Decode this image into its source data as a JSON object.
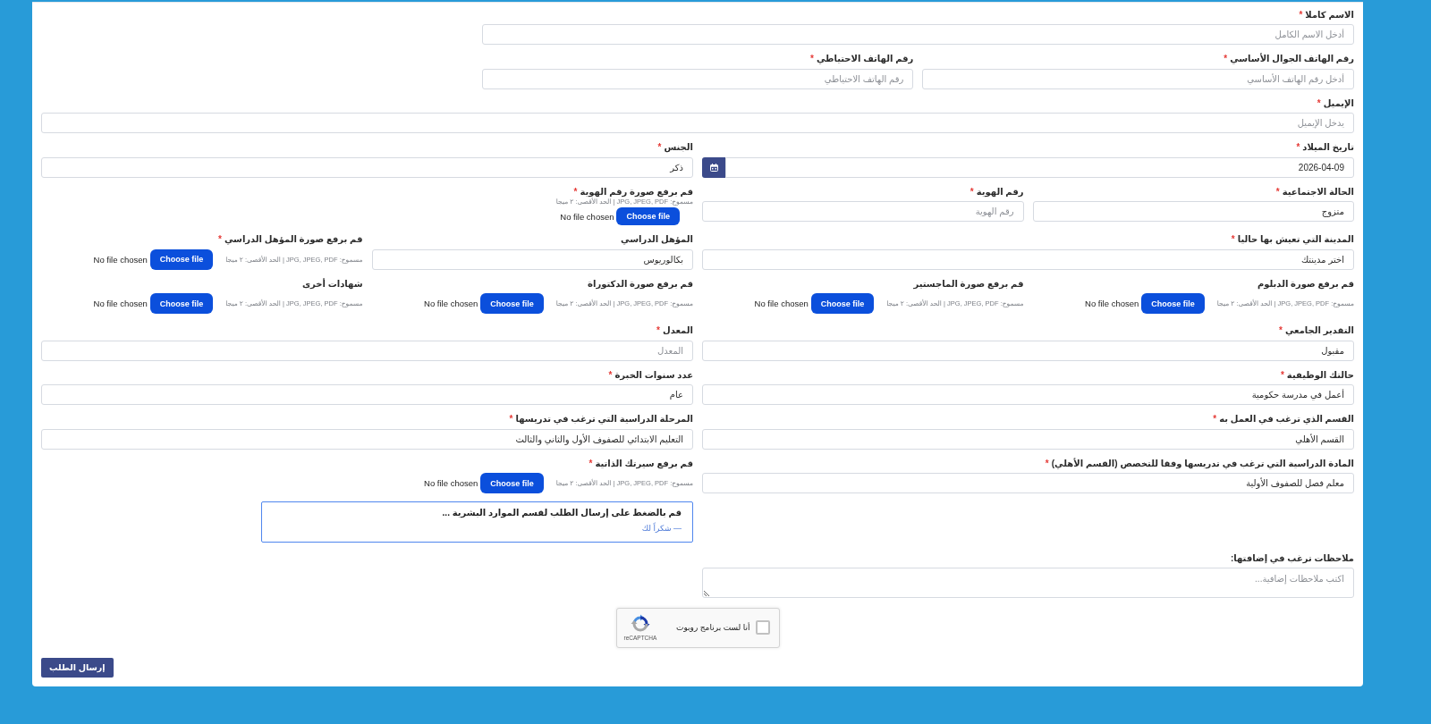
{
  "form": {
    "rows": [
      {
        "fields": [
          {
            "kind": "text",
            "label": "الاسم كاملا",
            "asterisk": "*",
            "placeholder": "أدخل الاسم الكامل"
          }
        ]
      },
      {
        "fields": [
          {
            "kind": "text",
            "label": "رقم الهاتف الجوال الأساسي",
            "asterisk": "*",
            "placeholder": "أدخل رقم الهاتف الأساسي"
          },
          {
            "kind": "text",
            "label": "رقم الهاتف الاحتياطي",
            "asterisk": "*",
            "placeholder": "رقم الهاتف الاحتياطي"
          }
        ]
      },
      {
        "fields": [
          {
            "kind": "text",
            "label": "الإيميل",
            "asterisk": "*",
            "placeholder": "يدخل الإيميل"
          }
        ]
      },
      {
        "fields": [
          {
            "kind": "date",
            "label": "تاريخ الميلاد",
            "asterisk": "*",
            "value": "2026-04-09"
          },
          {
            "kind": "text",
            "label": "الجنس",
            "asterisk": "*",
            "value": "ذكر"
          }
        ]
      },
      {
        "fields": [
          {
            "kind": "text",
            "label": "الحالة الاجتماعية",
            "asterisk": "*",
            "value": "متزوج"
          },
          {
            "kind": "text",
            "label": "رقم الهوية",
            "asterisk": "*",
            "placeholder": "رقم الهوية"
          },
          {
            "kind": "upload",
            "label": "قم برفع صورة رقم الهوية",
            "asterisk": "*",
            "hint": "مسموح: JPG, JPEG, PDF | الحد الأقصى: ٢ ميجا",
            "button": "Choose file",
            "status": "No file chosen"
          }
        ]
      },
      {
        "fields": [
          {
            "kind": "text",
            "label": "المدينة التي تعيش بها حاليا",
            "asterisk": "*",
            "value": "اختر مدينتك"
          },
          {
            "kind": "text",
            "label": "المؤهل الدراسي",
            "value": "بكالوريوس"
          },
          {
            "kind": "upload",
            "label": "قم برفع صورة المؤهل الدراسي",
            "asterisk": "*",
            "hint": "مسموح: JPG, JPEG, PDF | الحد الأقصى: ٢ ميجا",
            "button": "Choose file",
            "status": "No file chosen"
          }
        ]
      },
      {
        "fields": [
          {
            "kind": "upload",
            "label": "قم برفع صورة الدبلوم",
            "hint": "مسموح: JPG, JPEG, PDF | الحد الأقصى: ٢ ميجا",
            "button": "Choose file",
            "status": "No file chosen"
          },
          {
            "kind": "upload",
            "label": "قم برفع صورة الماجستير",
            "hint": "مسموح: JPG, JPEG, PDF | الحد الأقصى: ٢ ميجا",
            "button": "Choose file",
            "status": "No file chosen"
          },
          {
            "kind": "upload",
            "label": "قم برفع صورة الدكتوراة",
            "hint": "مسموح: JPG, JPEG, PDF | الحد الأقصى: ٢ ميجا",
            "button": "Choose file",
            "status": "No file chosen"
          },
          {
            "kind": "upload",
            "label": "شهادات أخرى",
            "hint": "مسموح: JPG, JPEG, PDF | الحد الأقصى: ٢ ميجا",
            "button": "Choose file",
            "status": "No file chosen"
          }
        ]
      },
      {
        "fields": [
          {
            "kind": "text",
            "label": "التقدير الجامعي",
            "asterisk": "*",
            "value": "مقبول"
          },
          {
            "kind": "text",
            "label": "المعدل",
            "asterisk": "*",
            "placeholder": "المعدل"
          }
        ]
      },
      {
        "fields": [
          {
            "kind": "text",
            "label": "حالتك الوظيفية",
            "asterisk": "*",
            "value": "أعمل في مدرسة حكومية"
          },
          {
            "kind": "text",
            "label": "عدد سنوات الخبرة",
            "asterisk": "*",
            "value": "عام"
          }
        ]
      },
      {
        "fields": [
          {
            "kind": "text",
            "label": "القسم الذي ترغب في العمل به",
            "asterisk": "*",
            "value": "القسم الأهلي"
          },
          {
            "kind": "text",
            "label": "المرحلة الدراسية التي ترغب في تدريسها",
            "asterisk": "*",
            "value": "التعليم الابتدائي للصفوف الأول والثاني والثالث"
          }
        ]
      },
      {
        "fields": [
          {
            "kind": "text",
            "label": "المادة الدراسية التي ترغب في تدريسها وفقا للتخصص (القسم الأهلي)",
            "asterisk": "*",
            "value": "معلم فصل للصفوف الأولية"
          },
          {
            "kind": "upload",
            "label": "قم برفع سيرتك الذاتية",
            "asterisk": "*",
            "hint": "مسموح: JPG, JPEG, PDF | الحد الأقصى: ٢ ميجا",
            "button": "Choose file",
            "status": "No file chosen"
          }
        ]
      }
    ]
  },
  "notice": {
    "text": "قم بالضغط على إرسال الطلب لقسم الموارد البشرية ...",
    "signature": "— شكراً لك"
  },
  "notes": {
    "label": "ملاحظات ترغب في إضافتها:",
    "placeholder": "اكتب ملاحظات إضافية..."
  },
  "recaptcha": {
    "label": "أنا لست برنامج روبوت",
    "checked": false,
    "brand": "reCAPTCHA"
  },
  "submit_button": "إرسال الطلب"
}
